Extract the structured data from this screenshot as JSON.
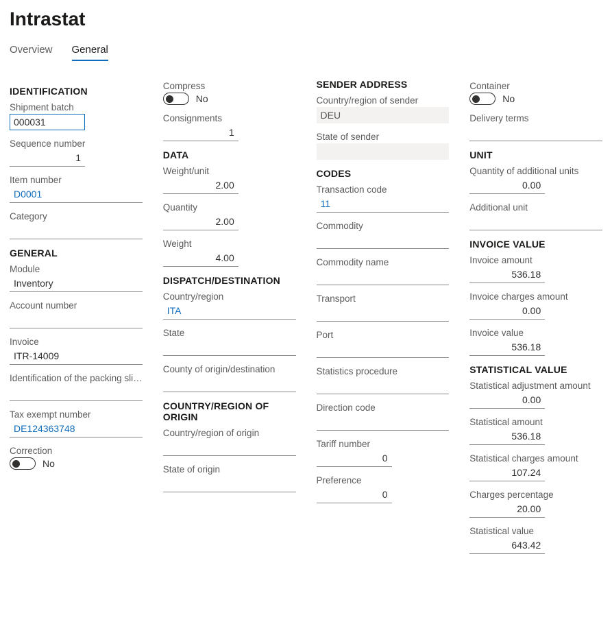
{
  "page": {
    "title": "Intrastat"
  },
  "tabs": {
    "overview": "Overview",
    "general": "General"
  },
  "toggle_no": "No",
  "col1": {
    "identification": {
      "heading": "IDENTIFICATION",
      "shipment_batch_label": "Shipment batch",
      "shipment_batch": "000031",
      "sequence_label": "Sequence number",
      "sequence": "1",
      "item_number_label": "Item number",
      "item_number": "D0001",
      "category_label": "Category",
      "category": ""
    },
    "general": {
      "heading": "GENERAL",
      "module_label": "Module",
      "module": "Inventory",
      "account_label": "Account number",
      "account": "",
      "invoice_label": "Invoice",
      "invoice": "ITR-14009",
      "packing_slip_label": "Identification of the packing slip ...",
      "packing_slip": "",
      "tax_exempt_label": "Tax exempt number",
      "tax_exempt": "DE124363748",
      "correction_label": "Correction"
    }
  },
  "col2": {
    "compress_label": "Compress",
    "consignments_label": "Consignments",
    "consignments": "1",
    "data": {
      "heading": "DATA",
      "weight_unit_label": "Weight/unit",
      "weight_unit": "2.00",
      "quantity_label": "Quantity",
      "quantity": "2.00",
      "weight_label": "Weight",
      "weight": "4.00"
    },
    "dispatch": {
      "heading": "DISPATCH/DESTINATION",
      "country_label": "Country/region",
      "country": "ITA",
      "state_label": "State",
      "state": "",
      "county_label": "County of origin/destination",
      "county": ""
    },
    "origin": {
      "heading": "COUNTRY/REGION OF ORIGIN",
      "country_label": "Country/region of origin",
      "country": "",
      "state_label": "State of origin",
      "state": ""
    }
  },
  "col3": {
    "sender": {
      "heading": "SENDER ADDRESS",
      "country_label": "Country/region of sender",
      "country": "DEU",
      "state_label": "State of sender",
      "state": ""
    },
    "codes": {
      "heading": "CODES",
      "txn_label": "Transaction code",
      "txn": "11",
      "commodity_label": "Commodity",
      "commodity": "",
      "commodity_name_label": "Commodity name",
      "commodity_name": "",
      "transport_label": "Transport",
      "transport": "",
      "port_label": "Port",
      "port": "",
      "stats_proc_label": "Statistics procedure",
      "stats_proc": "",
      "direction_label": "Direction code",
      "direction": "",
      "tariff_label": "Tariff number",
      "tariff": "0",
      "preference_label": "Preference",
      "preference": "0"
    }
  },
  "col4": {
    "container_label": "Container",
    "delivery_label": "Delivery terms",
    "delivery": "",
    "unit": {
      "heading": "UNIT",
      "qty_add_label": "Quantity of additional units",
      "qty_add": "0.00",
      "add_unit_label": "Additional unit",
      "add_unit": ""
    },
    "invoice": {
      "heading": "INVOICE VALUE",
      "amount_label": "Invoice amount",
      "amount": "536.18",
      "charges_label": "Invoice charges amount",
      "charges": "0.00",
      "value_label": "Invoice value",
      "value": "536.18"
    },
    "stat": {
      "heading": "STATISTICAL VALUE",
      "adj_label": "Statistical adjustment amount",
      "adj": "0.00",
      "amount_label": "Statistical amount",
      "amount": "536.18",
      "charges_label": "Statistical charges amount",
      "charges": "107.24",
      "pct_label": "Charges percentage",
      "pct": "20.00",
      "value_label": "Statistical value",
      "value": "643.42"
    }
  }
}
